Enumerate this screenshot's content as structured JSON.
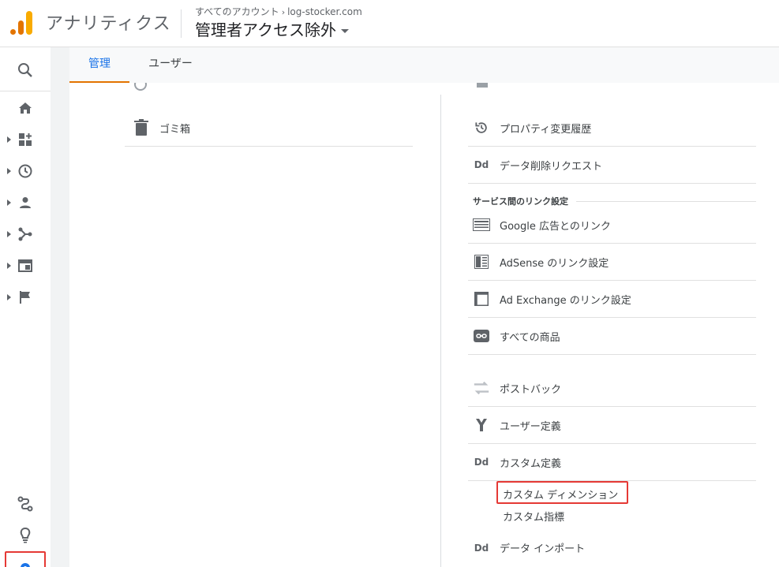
{
  "header": {
    "app_title": "アナリティクス",
    "breadcrumb_all": "すべてのアカウント",
    "breadcrumb_property": "log-stocker.com",
    "view_name": "管理者アクセス除外"
  },
  "tabs": [
    {
      "label": "管理",
      "active": true
    },
    {
      "label": "ユーザー",
      "active": false
    }
  ],
  "nav": {
    "icons": [
      "search-icon",
      "home-icon",
      "customization-icon",
      "realtime-icon",
      "audience-icon",
      "acquisition-icon",
      "behavior-icon",
      "conversions-icon",
      "attribution-icon",
      "discover-icon",
      "admin-gear-icon"
    ]
  },
  "left_column": {
    "items": [
      {
        "label": "ゴミ箱",
        "icon": "trash-icon"
      }
    ]
  },
  "right_column": {
    "items_top": [
      {
        "label": "プロパティ変更履歴",
        "icon": "history-icon"
      },
      {
        "label": "データ削除リクエスト",
        "icon": "dd-icon"
      }
    ],
    "section_title": "サービス間のリンク設定",
    "link_items": [
      {
        "label": "Google 広告とのリンク",
        "icon": "google-ads-icon"
      },
      {
        "label": "AdSense のリンク設定",
        "icon": "adsense-icon"
      },
      {
        "label": "Ad Exchange のリンク設定",
        "icon": "ad-exchange-icon"
      },
      {
        "label": "すべての商品",
        "icon": "link-icon"
      }
    ],
    "other_items": [
      {
        "label": "ポストバック",
        "icon": "postback-icon"
      },
      {
        "label": "ユーザー定義",
        "icon": "user-defined-icon"
      },
      {
        "label": "カスタム定義",
        "icon": "dd-icon"
      }
    ],
    "custom_sublinks": [
      {
        "label": "カスタム ディメンション",
        "highlighted": true
      },
      {
        "label": "カスタム指標",
        "highlighted": false
      }
    ],
    "data_import": {
      "label": "データ インポート",
      "icon": "dd-icon"
    }
  },
  "icon_text": {
    "dd": "Dd",
    "chevron": "›"
  },
  "colors": {
    "accent_blue": "#1a73e8",
    "tab_underline": "#e37400",
    "highlight_red": "#e53935",
    "logo_orange": "#e37400",
    "logo_yellow": "#f9ab00"
  }
}
